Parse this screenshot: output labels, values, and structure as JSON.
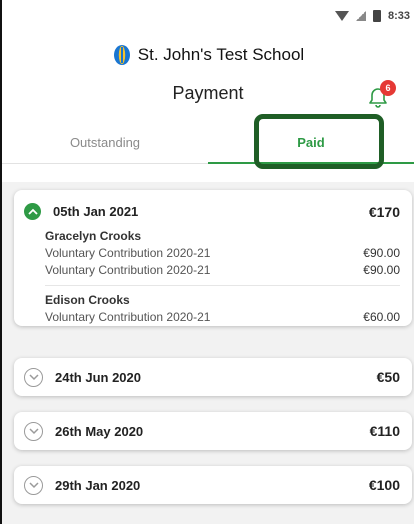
{
  "status_bar": {
    "time": "8:33"
  },
  "header": {
    "school_name": "St. John's Test School",
    "page_title": "Payment",
    "notification_count": "6"
  },
  "tabs": [
    {
      "label": "Outstanding",
      "active": false
    },
    {
      "label": "Paid",
      "active": true
    }
  ],
  "payments": [
    {
      "date": "05th Jan 2021",
      "total": "€170",
      "expanded": true,
      "payers": [
        {
          "name": "Gracelyn Crooks",
          "lines": [
            {
              "description": "Voluntary Contribution 2020-21",
              "amount": "€90.00"
            },
            {
              "description": "Voluntary Contribution 2020-21",
              "amount": "€90.00"
            }
          ]
        },
        {
          "name": "Edison Crooks",
          "lines": [
            {
              "description": "Voluntary Contribution 2020-21",
              "amount": "€60.00"
            }
          ]
        }
      ]
    },
    {
      "date": "24th Jun 2020",
      "total": "€50",
      "expanded": false
    },
    {
      "date": "26th May 2020",
      "total": "€110",
      "expanded": false
    },
    {
      "date": "29th Jan 2020",
      "total": "€100",
      "expanded": false
    }
  ],
  "colors": {
    "accent": "#2e9a45",
    "highlight": "#1f5e26",
    "badge": "#e53935",
    "logo_blue": "#1976d2",
    "logo_yellow": "#f6c22b"
  }
}
